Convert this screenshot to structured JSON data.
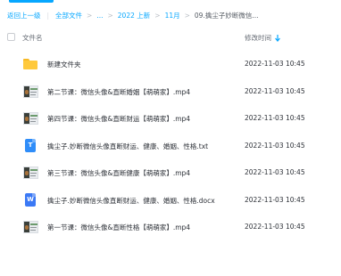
{
  "breadcrumb": {
    "back": "返回上一级",
    "root": "全部文件",
    "ellipsis": "...",
    "crumb1": "2022 上新",
    "crumb2": "11月",
    "current": "09.擒尘子妙断微信..."
  },
  "table": {
    "col_name": "文件名",
    "col_time": "修改时间"
  },
  "files": [
    {
      "name": "新建文件夹",
      "time": "2022-11-03 10:45",
      "type": "folder"
    },
    {
      "name": "第二节课：微信头像&直断婚姻【萌萌家】.mp4",
      "time": "2022-11-03 10:45",
      "type": "video"
    },
    {
      "name": "第四节课：微信头像&直断财运【萌萌家】.mp4",
      "time": "2022-11-03 10:45",
      "type": "video"
    },
    {
      "name": "擒尘子.妙断微信头像直断财运、健康、婚姻、性格.txt",
      "time": "2022-11-03 10:45",
      "type": "txt"
    },
    {
      "name": "第三节课：微信头像&直断健康【萌萌家】.mp4",
      "time": "2022-11-03 10:45",
      "type": "video"
    },
    {
      "name": "擒尘子.妙断微信头像直断财运、健康、婚姻、性格.docx",
      "time": "2022-11-03 10:45",
      "type": "docx"
    },
    {
      "name": "第一节课：微信头像&直断性格【萌萌家】.mp4",
      "time": "2022-11-03 10:45",
      "type": "video"
    }
  ],
  "icons": {
    "txt_glyph": "T",
    "docx_glyph": "W"
  },
  "colors": {
    "accent": "#06a7ff",
    "folder": "#ffc93c"
  }
}
